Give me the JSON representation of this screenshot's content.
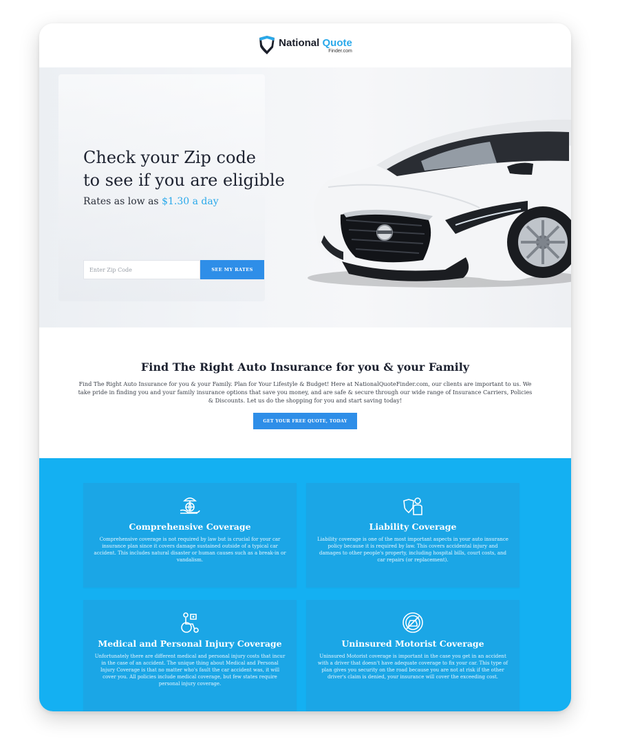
{
  "brand": {
    "name_main": "National",
    "name_accent": "Quote",
    "name_sub": "Finder.com",
    "colors": {
      "accent": "#2aa9ea",
      "button": "#2e8ee8",
      "coverage_bg": "#14b0f2",
      "dark": "#1d2230"
    }
  },
  "hero": {
    "title_line1": "Check your Zip code",
    "title_line2": "to see if you are eligible",
    "rate_prefix": "Rates as low as",
    "rate_price": "$1.30 a day",
    "zip_placeholder": "Enter Zip Code",
    "zip_button": "SEE MY RATES"
  },
  "intro": {
    "heading": "Find The Right Auto Insurance for you & your Family",
    "body": "Find The Right Auto Insurance for you & your Family. Plan for Your Lifestyle & Budget! Here at NationalQuoteFinder.com, our clients are important to us. We take pride in finding you and your family insurance options that save you money, and are safe & secure through our wide range of Insurance Carriers, Policies & Discounts. Let us do the shopping for you and start saving today!",
    "cta": "GET YOUR FREE QUOTE, TODAY"
  },
  "coverage": {
    "cards": [
      {
        "icon": "globe-hand-umbrella-icon",
        "title": "Comprehensive Coverage",
        "text": "Comprehensive coverage is not required by law but is crucial for your car insurance plan since it covers damage sustained outside of a typical car accident. This includes natural disaster or human causes such as a break-in or vandalism."
      },
      {
        "icon": "person-shield-icon",
        "title": "Liability Coverage",
        "text": "Liability coverage is one of the most important aspects in your auto insurance policy because it is required by law. This covers accidental injury and damages to other people's property, including hospital bills, court costs, and car repairs (or replacement)."
      },
      {
        "icon": "wheelchair-icon",
        "title": "Medical and Personal Injury Coverage",
        "text": "Unfortunately there are different medical and personal injury costs that incur in the case of an accident. The unique thing about Medical and Personal Injury Coverage is that no matter who's fault the car accident was, it will cover you. All policies include medical coverage, but few states require personal injury coverage."
      },
      {
        "icon": "no-car-icon",
        "title": "Uninsured Motorist Coverage",
        "text": "Uninsured Motorist coverage is important in the case you get in an accident with a driver that doesn't have adequate coverage to fix your car. This type of plan gives you security on the road because you are not at risk if the other driver's claim is denied, your insurance will cover the exceeding cost."
      }
    ]
  }
}
